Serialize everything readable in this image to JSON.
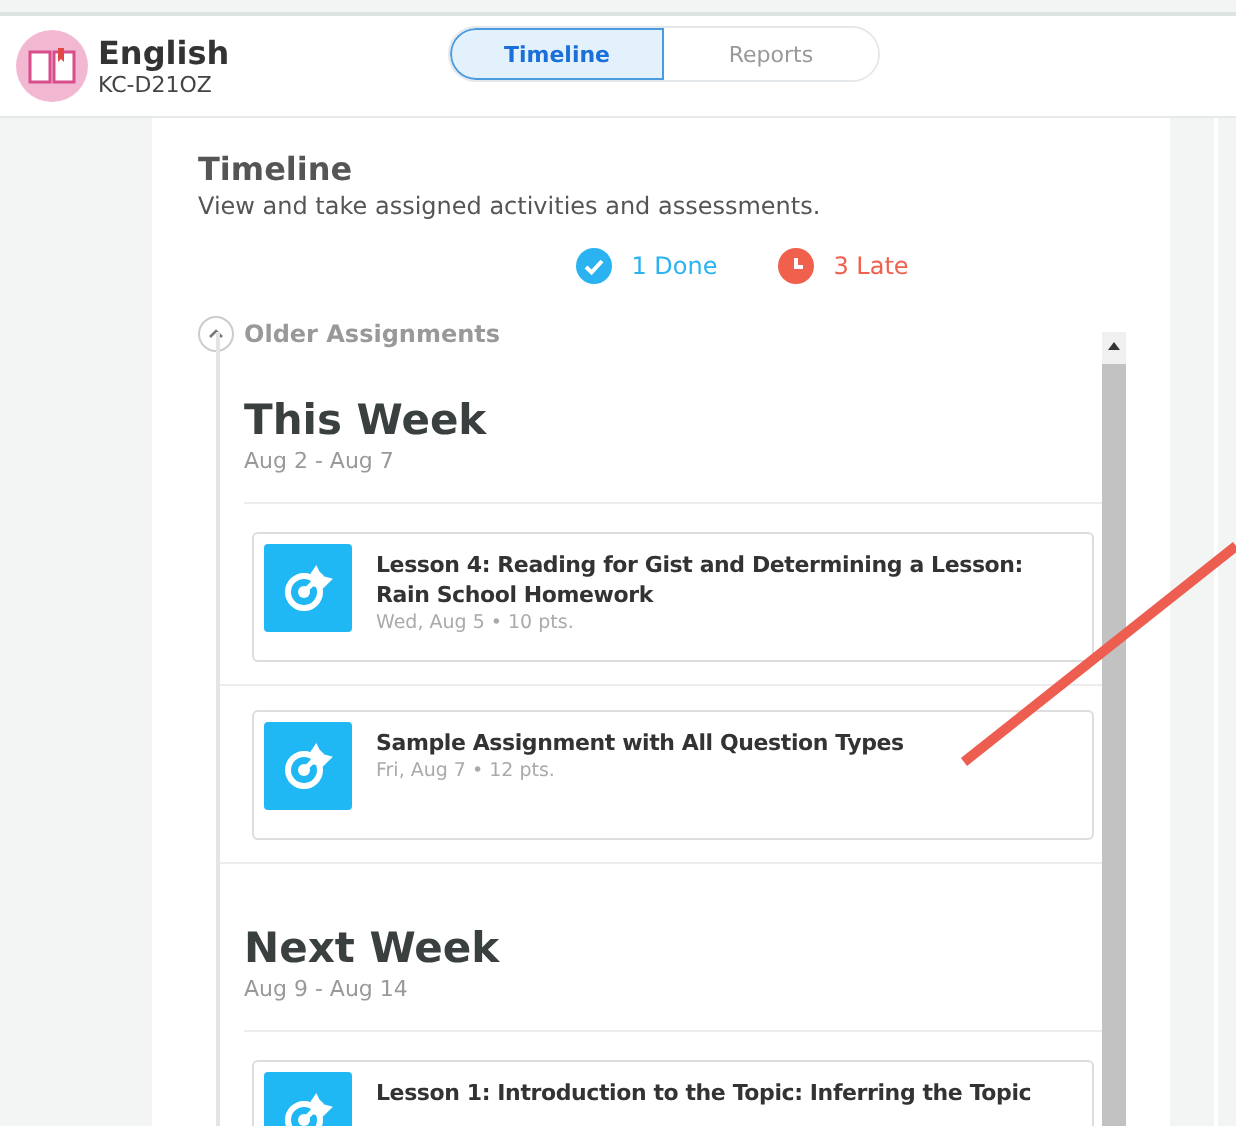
{
  "course": {
    "name": "English",
    "code": "KC-D21OZ"
  },
  "tabs": [
    {
      "label": "Timeline",
      "selected": true
    },
    {
      "label": "Reports",
      "selected": false
    }
  ],
  "page": {
    "title": "Timeline",
    "subtitle": "View and take assigned activities and assessments."
  },
  "stats": [
    {
      "kind": "done",
      "text": "1 Done"
    },
    {
      "kind": "late",
      "text": "3 Late"
    }
  ],
  "older": {
    "label": "Older Assignments",
    "expanded": true
  },
  "weeks": [
    {
      "title": "This Week",
      "range": "Aug 2 - Aug 7",
      "assignments": [
        {
          "title": "Lesson 4: Reading for Gist and Determining a Lesson: Rain School Homework",
          "meta": "Wed, Aug 5 • 10 pts."
        },
        {
          "title": "Sample Assignment with All Question Types",
          "meta": "Fri, Aug 7 • 12 pts."
        }
      ]
    },
    {
      "title": "Next Week",
      "range": "Aug 9 - Aug 14",
      "assignments": [
        {
          "title": "Lesson 1: Introduction to the Topic: Inferring the Topic"
        }
      ]
    }
  ]
}
